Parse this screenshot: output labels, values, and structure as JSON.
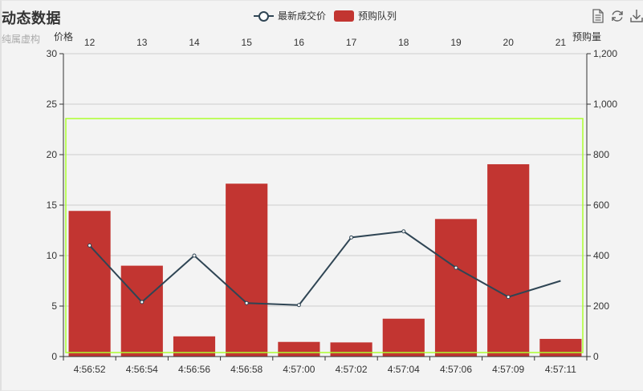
{
  "title": "动态数据",
  "subtitle": "纯属虚构",
  "legend": {
    "line_label": "最新成交价",
    "bar_label": "预购队列"
  },
  "toolbox": [
    "data-view-icon",
    "refresh-icon",
    "save-image-icon"
  ],
  "colors": {
    "bar": "#c23531",
    "line": "#2f4554",
    "brush": "#adff2f",
    "grid": "#cccccc"
  },
  "chart_data": {
    "type": "bar",
    "title": "动态数据",
    "subtitle": "纯属虚构",
    "categories": [
      "4:56:52",
      "4:56:54",
      "4:56:56",
      "4:56:58",
      "4:57:00",
      "4:57:02",
      "4:57:04",
      "4:57:06",
      "4:57:09",
      "4:57:11"
    ],
    "x2_categories": [
      "12",
      "13",
      "14",
      "15",
      "16",
      "17",
      "18",
      "19",
      "20",
      "21"
    ],
    "series": [
      {
        "name": "预购队列",
        "type": "bar",
        "yAxis": "right",
        "values": [
          577,
          360,
          80,
          685,
          58,
          56,
          150,
          545,
          762,
          70
        ]
      },
      {
        "name": "最新成交价",
        "type": "line",
        "yAxis": "left",
        "values": [
          11.0,
          5.4,
          10.0,
          5.3,
          5.1,
          11.8,
          12.4,
          8.8,
          5.9,
          7.5
        ]
      }
    ],
    "y_left": {
      "label": "价格",
      "min": 0,
      "max": 30,
      "ticks": [
        0,
        5,
        10,
        15,
        20,
        25,
        30
      ]
    },
    "y_right": {
      "label": "预购量",
      "min": 0,
      "max": 1200,
      "ticks": [
        0,
        200,
        400,
        600,
        800,
        "1,000",
        "1,200"
      ]
    },
    "grid": true,
    "legend_position": "top"
  }
}
